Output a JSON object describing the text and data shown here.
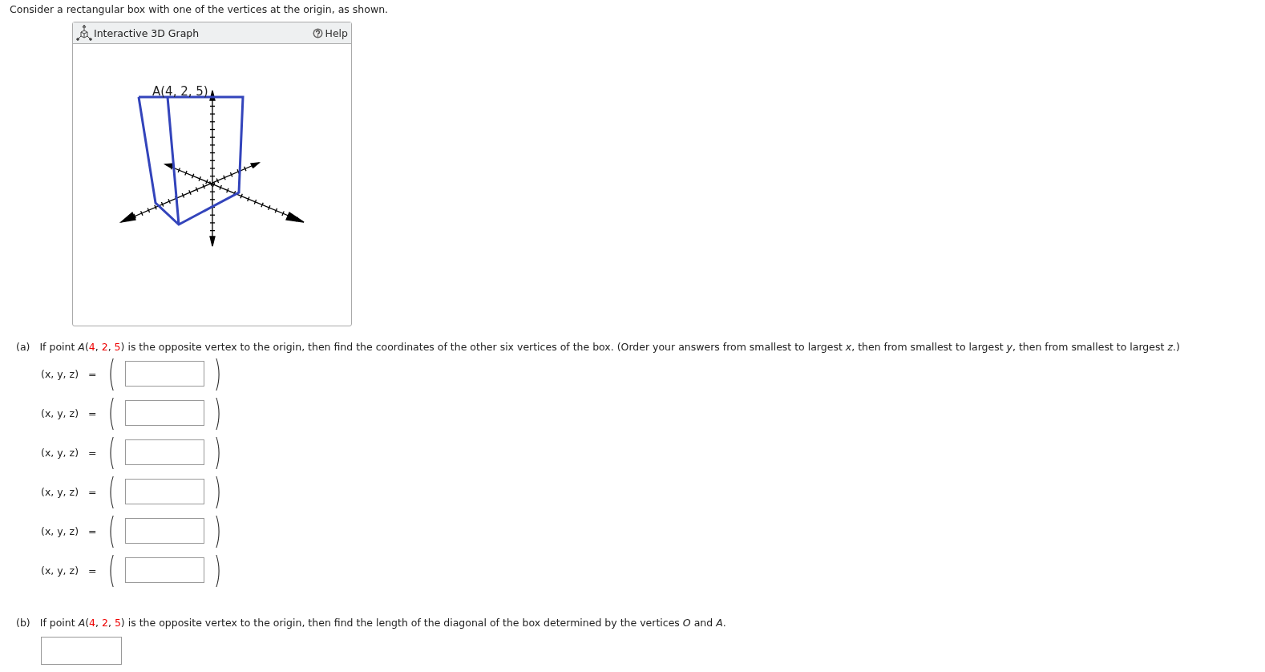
{
  "intro": "Consider a rectangular box with one of the vertices at the origin, as shown.",
  "graph": {
    "title": "Interactive 3D Graph",
    "help": "Help",
    "point_label": "A(4, 2, 5)"
  },
  "part_a": {
    "marker": "(a)",
    "question": [
      {
        "text": "If point *A*(",
        "kind": "text"
      },
      {
        "text": "4",
        "kind": "given"
      },
      {
        "text": ", ",
        "kind": "text"
      },
      {
        "text": "2",
        "kind": "given"
      },
      {
        "text": ", ",
        "kind": "text"
      },
      {
        "text": "5",
        "kind": "given"
      },
      {
        "text": ") is the opposite vertex to the origin, then find the coordinates of the other six vertices of the box. (Order your answers from smallest to largest *x*, then from smallest to largest *y*, then from smallest to largest *z*.)",
        "kind": "text"
      }
    ],
    "answers": [
      {
        "label": "(x, y, z)",
        "equals": "=",
        "open": "(",
        "close": ")"
      },
      {
        "label": "(x, y, z)",
        "equals": "=",
        "open": "(",
        "close": ")"
      },
      {
        "label": "(x, y, z)",
        "equals": "=",
        "open": "(",
        "close": ")"
      },
      {
        "label": "(x, y, z)",
        "equals": "=",
        "open": "(",
        "close": ")"
      },
      {
        "label": "(x, y, z)",
        "equals": "=",
        "open": "(",
        "close": ")"
      },
      {
        "label": "(x, y, z)",
        "equals": "=",
        "open": "(",
        "close": ")"
      }
    ]
  },
  "part_b": {
    "marker": "(b)",
    "question": [
      {
        "text": "If point *A*(",
        "kind": "text"
      },
      {
        "text": "4",
        "kind": "given"
      },
      {
        "text": ", ",
        "kind": "text"
      },
      {
        "text": "2",
        "kind": "given"
      },
      {
        "text": ", ",
        "kind": "text"
      },
      {
        "text": "5",
        "kind": "given"
      },
      {
        "text": ") is the opposite vertex to the origin, then find the length of the diagonal of the box determined by the vertices *O* and *A*.",
        "kind": "text"
      }
    ]
  }
}
